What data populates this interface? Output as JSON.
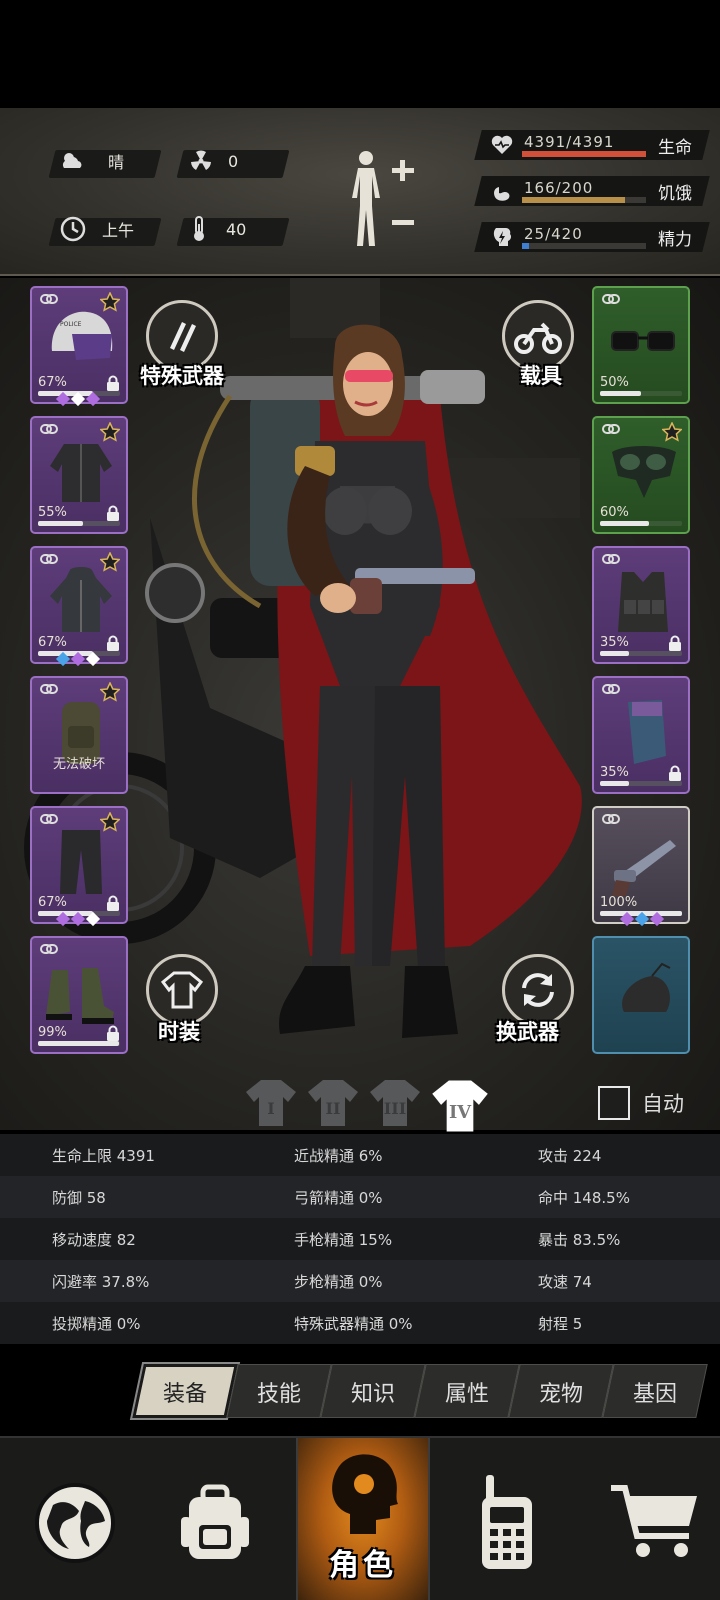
{
  "header": {
    "weather": "晴",
    "radiation": "0",
    "time_of_day": "上午",
    "temperature": "40",
    "health": {
      "value": "4391/4391",
      "label": "生命",
      "fill": 1.0,
      "color": "#d2503a"
    },
    "hunger": {
      "value": "166/200",
      "label": "饥饿",
      "fill": 0.83,
      "color": "#b9904a"
    },
    "energy": {
      "value": "25/420",
      "label": "精力",
      "fill": 0.06,
      "color": "#3f7fd2"
    }
  },
  "equipment": {
    "left": [
      {
        "name": "helmet",
        "pct": "67%",
        "durability": 0.67,
        "star": true,
        "locked": true,
        "gems": [
          "#b06de0",
          "#ffffff",
          "#b06de0"
        ]
      },
      {
        "name": "jacket",
        "pct": "55%",
        "durability": 0.55,
        "star": true,
        "locked": true,
        "gems": []
      },
      {
        "name": "coat",
        "pct": "67%",
        "durability": 0.67,
        "star": true,
        "locked": true,
        "gems": [
          "#4aa3e8",
          "#b06de0",
          "#ffffff"
        ]
      },
      {
        "name": "backpack",
        "text": "无法破坏",
        "star": true,
        "locked": false,
        "gems": []
      },
      {
        "name": "pants",
        "pct": "67%",
        "durability": 0.67,
        "star": true,
        "locked": true,
        "gems": [
          "#b06de0",
          "#b06de0",
          "#ffffff"
        ]
      },
      {
        "name": "boots",
        "pct": "99%",
        "durability": 0.99,
        "star": false,
        "locked": true,
        "gems": []
      }
    ],
    "right": [
      {
        "name": "glasses",
        "pct": "50%",
        "durability": 0.5,
        "star": false,
        "locked": false,
        "color": "green"
      },
      {
        "name": "mask",
        "pct": "60%",
        "durability": 0.6,
        "star": true,
        "locked": false,
        "color": "green"
      },
      {
        "name": "vest",
        "pct": "35%",
        "durability": 0.35,
        "star": false,
        "locked": true,
        "color": "purple"
      },
      {
        "name": "armband",
        "pct": "35%",
        "durability": 0.35,
        "star": false,
        "locked": true,
        "color": "purple"
      },
      {
        "name": "revolver",
        "pct": "100%",
        "durability": 1.0,
        "star": false,
        "locked": false,
        "color": "grey",
        "gems": [
          "#b06de0",
          "#4aa3e8",
          "#b06de0"
        ]
      },
      {
        "name": "sack",
        "color": "blue"
      }
    ]
  },
  "buttons": {
    "special_weapon": "特殊武器",
    "vehicle": "载具",
    "fashion": "时装",
    "swap_weapon": "换武器",
    "auto": "自动"
  },
  "outfits": [
    "I",
    "II",
    "III",
    "IV"
  ],
  "stats": [
    [
      "生命上限 4391",
      "近战精通 6%",
      "攻击 224"
    ],
    [
      "防御 58",
      "弓箭精通 0%",
      "命中 148.5%"
    ],
    [
      "移动速度 82",
      "手枪精通 15%",
      "暴击 83.5%"
    ],
    [
      "闪避率 37.8%",
      "步枪精通 0%",
      "攻速 74"
    ],
    [
      "投掷精通 0%",
      "特殊武器精通 0%",
      "射程 5"
    ]
  ],
  "tabs": [
    "装备",
    "技能",
    "知识",
    "属性",
    "宠物",
    "基因"
  ],
  "nav": {
    "role_label": "角色"
  }
}
